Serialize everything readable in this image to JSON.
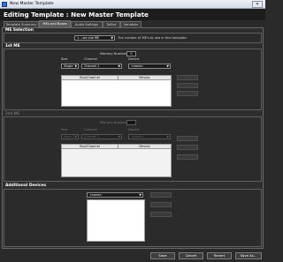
{
  "window": {
    "title": "New Master Template"
  },
  "header": {
    "title": "Editing Template : New Master Template"
  },
  "tabs": [
    {
      "label": "Template Summary"
    },
    {
      "label": "MEs and Buses"
    },
    {
      "label": "Audio Settings"
    },
    {
      "label": "Tallies"
    },
    {
      "label": "Variables"
    }
  ],
  "me_selection": {
    "title": "ME Selection",
    "count_value": "1 - use one ME",
    "description": "The number of ME's to use in this template."
  },
  "me1": {
    "title": "1st ME",
    "memory_label": "Memory Number:",
    "memory_value": "0",
    "size_label": "Size",
    "size_value": "Single",
    "channel_label": "Channel",
    "channel_value": "Channel 1",
    "device_label": "Device",
    "device_value": "<none>",
    "col_bus": "Bus/Channel",
    "col_device": "Device"
  },
  "me2": {
    "title": "2nd ME",
    "memory_label": "Memory Number:",
    "size_label": "Size",
    "size_value": "Input 1",
    "channel_label": "Channel",
    "channel_value": "Channel 1",
    "device_label": "Device",
    "device_value": "<none>",
    "col_bus": "Bus/Channel",
    "col_device": "Device"
  },
  "additional_devices": {
    "title": "Additional Devices",
    "device_value": "<none>"
  },
  "footer": {
    "save": "Save",
    "cancel": "Cancel",
    "revert": "Revert",
    "save_as": "Save As..."
  }
}
